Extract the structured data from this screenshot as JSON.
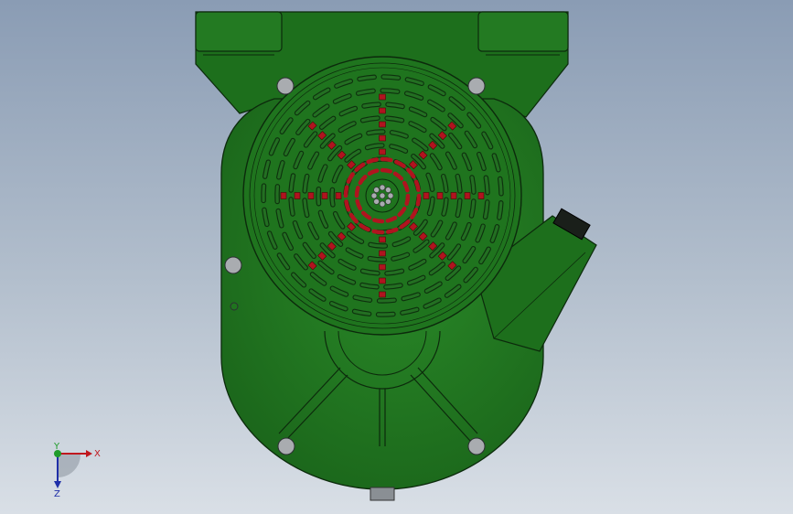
{
  "viewport": {
    "background_top": "#8a9cb4",
    "background_bottom": "#d9dfe6"
  },
  "model": {
    "body_color": "#1d6f1c",
    "edge_color": "#0c2a0c",
    "highlight_color": "#b0141f",
    "bolt_color": "#a9acb0",
    "icon": "hopper-model-icon"
  },
  "triad": {
    "x_label": "X",
    "y_label": "Y",
    "z_label": "Z",
    "x_color": "#c0181e",
    "y_color": "#1f9c2a",
    "z_color": "#1f2fa8"
  }
}
